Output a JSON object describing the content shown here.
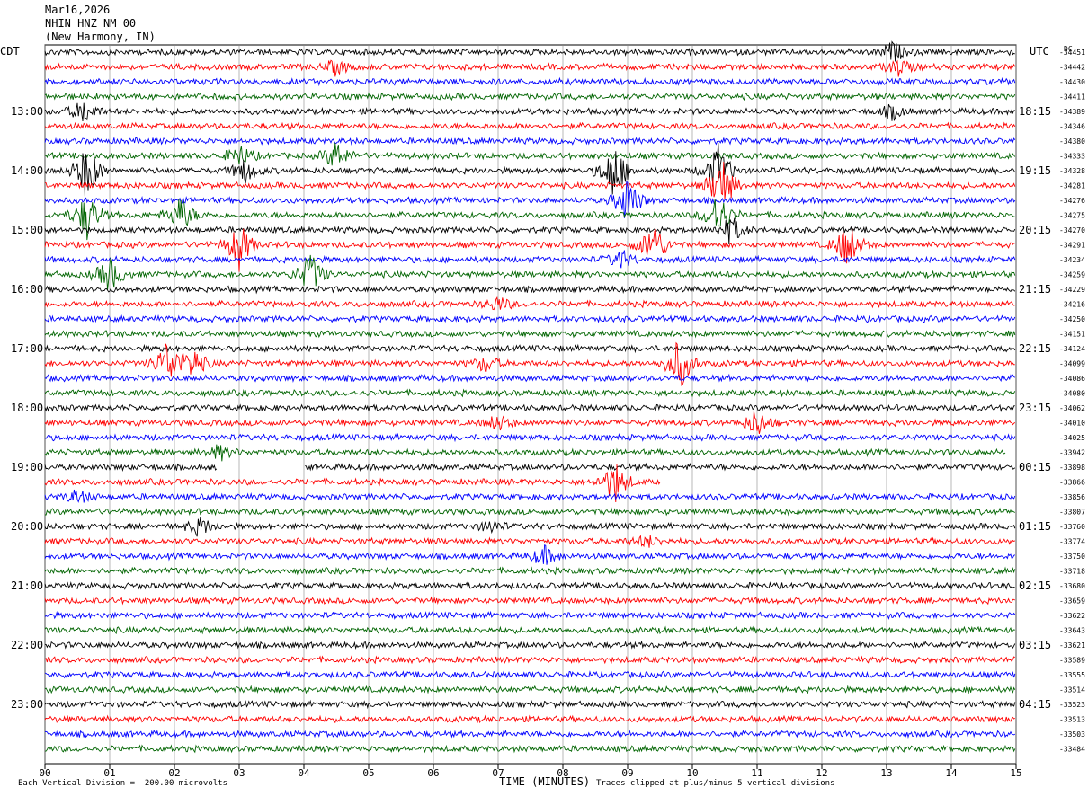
{
  "header": {
    "date": "Mar16,2026",
    "station": "NHIN HNZ NM 00",
    "location": "(New Harmony, IN)"
  },
  "left_tz": "CDT",
  "right_tz": "UTC",
  "dc_label": "DC",
  "footer": {
    "scale_note": "Each Vertical Division =  200.00 microvolts",
    "axis_title": "TIME (MINUTES)",
    "clip_note": "Traces clipped at plus/minus 5 vertical divisions"
  },
  "colors": {
    "trace_cycle": [
      "#000000",
      "#ff0000",
      "#0000ff",
      "#006400"
    ],
    "grid": "#888888"
  },
  "chart_data": {
    "type": "line",
    "title": "NHIN HNZ NM 00",
    "xlabel": "TIME (MINUTES)",
    "x_ticks": [
      "00",
      "01",
      "02",
      "03",
      "04",
      "05",
      "06",
      "07",
      "08",
      "09",
      "10",
      "11",
      "12",
      "13",
      "14",
      "15"
    ],
    "xlim": [
      0,
      15
    ],
    "rows_per_hour": 4,
    "minutes_per_row": 15,
    "left_hour_labels": [
      "13:00",
      "14:00",
      "15:00",
      "16:00",
      "17:00",
      "18:00",
      "19:00",
      "20:00",
      "21:00",
      "22:00",
      "23:00"
    ],
    "right_hour_labels": [
      "18:15",
      "19:15",
      "20:15",
      "21:15",
      "22:15",
      "23:15",
      "00:15",
      "01:15",
      "02:15",
      "03:15",
      "04:15"
    ],
    "row_dc_offsets": [
      "-34451",
      "-34442",
      "-34430",
      "-34411",
      "-34389",
      "-34346",
      "-34380",
      "-34333",
      "-34328",
      "-34281",
      "-34276",
      "-34275",
      "-34270",
      "-34291",
      "-34234",
      "-34259",
      "-34229",
      "-34216",
      "-34250",
      "-34151",
      "-34124",
      "-34099",
      "-34086",
      "-34080",
      "-34062",
      "-34010",
      "-34025",
      "-33942",
      "-33898",
      "-33866",
      "-33856",
      "-33807",
      "-33760",
      "-33774",
      "-33750",
      "-33718",
      "-33680",
      "-33659",
      "-33622",
      "-33643",
      "-33621",
      "-33589",
      "-33555",
      "-33514",
      "-33523",
      "-33513",
      "-33503",
      "-33484"
    ],
    "events": [
      {
        "row": 0,
        "minute": 13.1,
        "amp": 0.8
      },
      {
        "row": 1,
        "minute": 4.5,
        "amp": 0.6
      },
      {
        "row": 1,
        "minute": 13.2,
        "amp": 0.7
      },
      {
        "row": 4,
        "minute": 0.6,
        "amp": 1.0
      },
      {
        "row": 4,
        "minute": 13.1,
        "amp": 0.6
      },
      {
        "row": 7,
        "minute": 4.5,
        "amp": 1.2
      },
      {
        "row": 7,
        "minute": 3.0,
        "amp": 0.9
      },
      {
        "row": 8,
        "minute": 0.65,
        "amp": 2.5
      },
      {
        "row": 8,
        "minute": 3.1,
        "amp": 1.0
      },
      {
        "row": 8,
        "minute": 8.8,
        "amp": 2.5
      },
      {
        "row": 8,
        "minute": 10.4,
        "amp": 2.2
      },
      {
        "row": 9,
        "minute": 10.45,
        "amp": 2.5
      },
      {
        "row": 10,
        "minute": 9.0,
        "amp": 2.0
      },
      {
        "row": 11,
        "minute": 0.65,
        "amp": 2.0
      },
      {
        "row": 11,
        "minute": 2.1,
        "amp": 1.5
      },
      {
        "row": 11,
        "minute": 10.4,
        "amp": 2.0
      },
      {
        "row": 12,
        "minute": 10.6,
        "amp": 1.2
      },
      {
        "row": 13,
        "minute": 3.0,
        "amp": 2.0
      },
      {
        "row": 13,
        "minute": 9.4,
        "amp": 2.0
      },
      {
        "row": 13,
        "minute": 12.4,
        "amp": 2.0
      },
      {
        "row": 14,
        "minute": 8.9,
        "amp": 0.8
      },
      {
        "row": 15,
        "minute": 1.0,
        "amp": 1.5
      },
      {
        "row": 15,
        "minute": 4.1,
        "amp": 1.8
      },
      {
        "row": 17,
        "minute": 7.0,
        "amp": 0.6
      },
      {
        "row": 21,
        "minute": 1.9,
        "amp": 2.0
      },
      {
        "row": 21,
        "minute": 2.3,
        "amp": 1.2
      },
      {
        "row": 21,
        "minute": 9.8,
        "amp": 2.2
      },
      {
        "row": 21,
        "minute": 6.8,
        "amp": 0.7
      },
      {
        "row": 25,
        "minute": 7.0,
        "amp": 0.7
      },
      {
        "row": 25,
        "minute": 11.0,
        "amp": 1.2
      },
      {
        "row": 27,
        "minute": 2.7,
        "amp": 0.6
      },
      {
        "row": 29,
        "minute": 8.8,
        "amp": 1.8
      },
      {
        "row": 30,
        "minute": 0.5,
        "amp": 0.6
      },
      {
        "row": 32,
        "minute": 2.4,
        "amp": 0.8
      },
      {
        "row": 32,
        "minute": 6.9,
        "amp": 0.5
      },
      {
        "row": 34,
        "minute": 7.7,
        "amp": 0.8
      },
      {
        "row": 33,
        "minute": 9.3,
        "amp": 0.5
      }
    ],
    "gaps": [
      {
        "row": 28,
        "start": 2.65,
        "end": 4.0
      },
      {
        "row": 29,
        "start": 9.5,
        "end": 15.0
      }
    ],
    "short_row": {
      "row": 27,
      "end": 14.85
    }
  }
}
